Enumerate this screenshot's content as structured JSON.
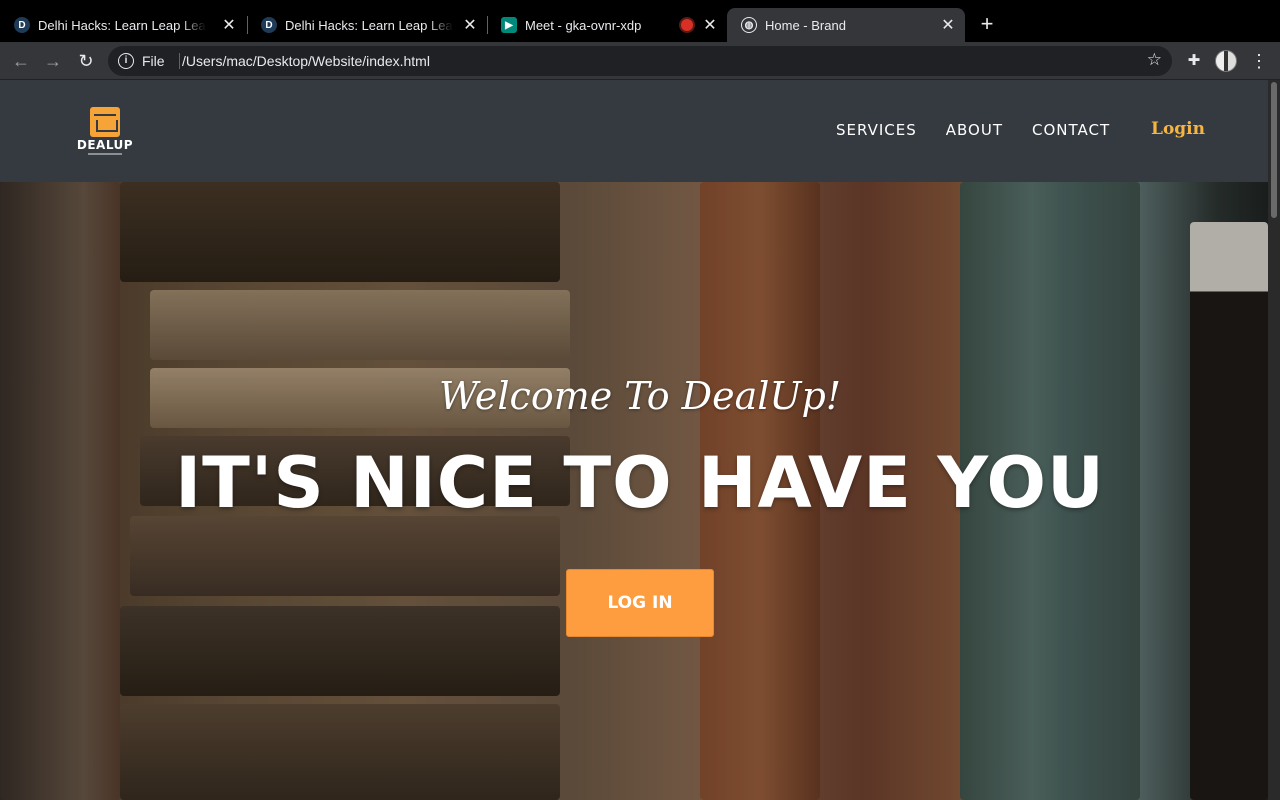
{
  "browser": {
    "tabs": [
      {
        "title": "Delhi Hacks: Learn Leap Lead",
        "favicon": "D"
      },
      {
        "title": "Delhi Hacks: Learn Leap Lead",
        "favicon": "D"
      },
      {
        "title": "Meet - gka-ovnr-xdp"
      },
      {
        "title": "Home - Brand"
      }
    ],
    "address": {
      "scheme_label": "File",
      "url": "/Users/mac/Desktop/Website/index.html"
    }
  },
  "site": {
    "brand": {
      "name": "DEALUP"
    },
    "nav": {
      "items": [
        "SERVICES",
        "ABOUT",
        "CONTACT"
      ],
      "login": "Login"
    },
    "hero": {
      "welcome": "Welcome To DealUp!",
      "headline": "IT'S NICE TO HAVE YOU",
      "cta": "LOG IN"
    }
  },
  "colors": {
    "accent": "#fd9d3f",
    "nav_bg": "#343a40",
    "login_link": "#f6b443"
  }
}
